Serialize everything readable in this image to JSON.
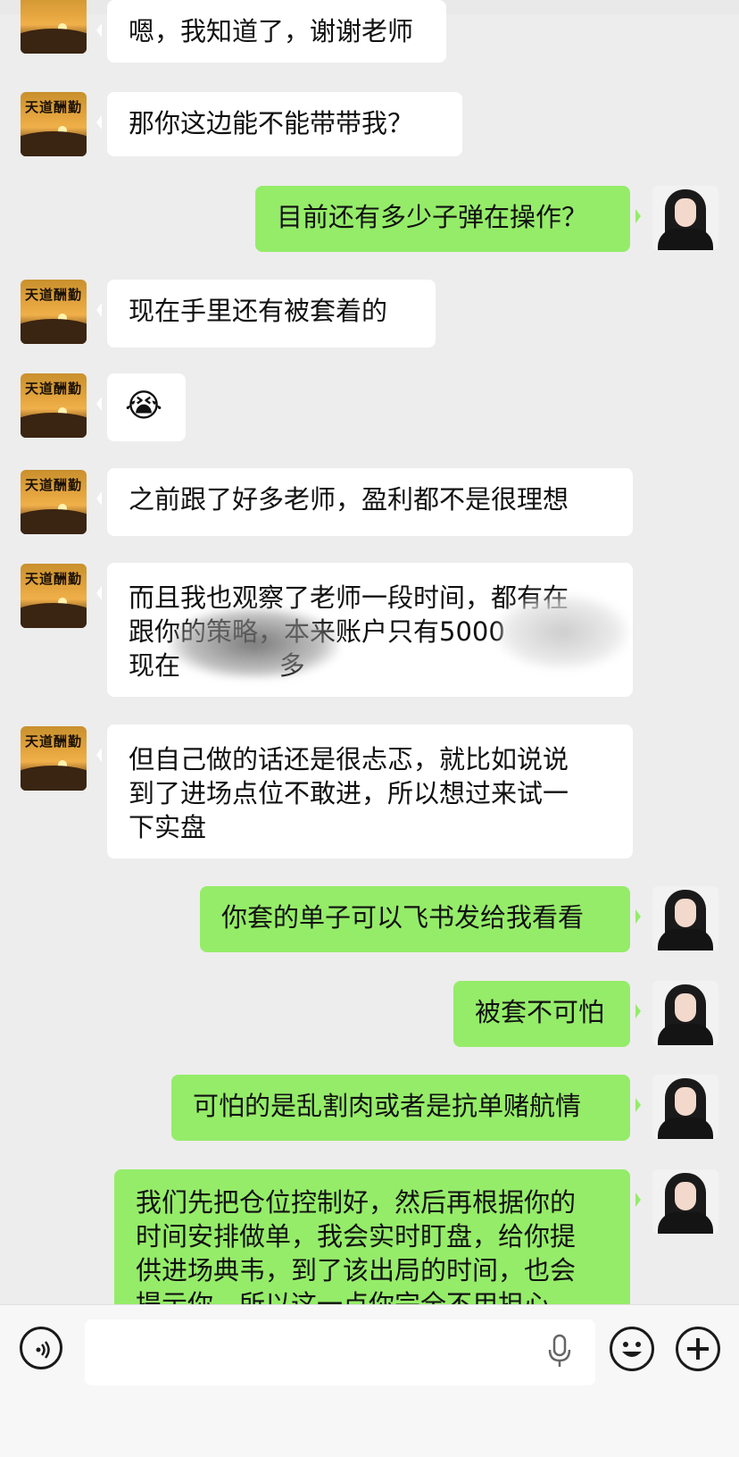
{
  "messages": [
    {
      "side": "left",
      "text": "嗯，我知道了，谢谢老师"
    },
    {
      "side": "left",
      "text": "那你这边能不能带带我？"
    },
    {
      "side": "right",
      "text": "目前还有多少子弹在操作？"
    },
    {
      "side": "left",
      "text": "现在手里还有被套着的"
    },
    {
      "side": "left",
      "text": "😭"
    },
    {
      "side": "left",
      "text": "之前跟了好多老师，盈利都不是很理想"
    },
    {
      "side": "left",
      "text": "而且我也观察了老师一段时间，都有在\n跟你的策略，本来账户只有5000\n现在            多"
    },
    {
      "side": "left",
      "text": "但自己做的话还是很忐忑，就比如说说\n到了进场点位不敢进，所以想过来试一\n下实盘"
    },
    {
      "side": "right",
      "text": "你套的单子可以飞书发给我看看"
    },
    {
      "side": "right",
      "text": "被套不可怕"
    },
    {
      "side": "right",
      "text": "可怕的是乱割肉或者是抗单赌航情"
    },
    {
      "side": "right",
      "text": "我们先把仓位控制好，然后再根据你的\n时间安排做单，我会实时盯盘，给你提\n供进场典韦，到了该出局的时间，也会\n提示你，所以这一点你完全不用担心"
    }
  ],
  "sender_avatar": {
    "label": "天道酬勤"
  },
  "input_bar": {
    "placeholder": ""
  }
}
